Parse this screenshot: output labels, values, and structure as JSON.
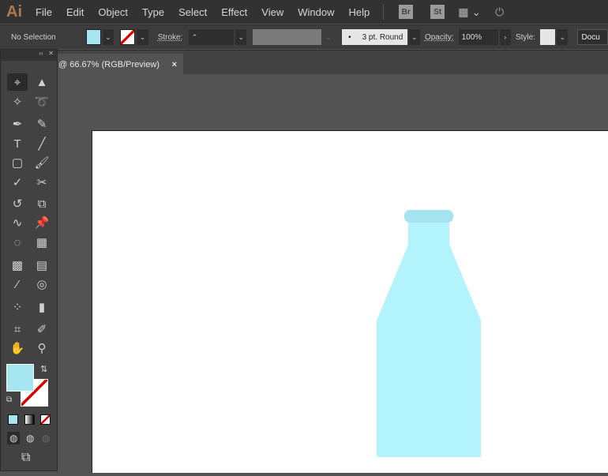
{
  "app": {
    "logo": "Ai"
  },
  "menu": [
    "File",
    "Edit",
    "Object",
    "Type",
    "Select",
    "Effect",
    "View",
    "Window",
    "Help"
  ],
  "app_buttons": {
    "bridge": "Br",
    "stock": "St"
  },
  "control": {
    "selection": "No Selection",
    "stroke_label": "Stroke:",
    "brush": "3 pt. Round",
    "opacity_label": "Opacity:",
    "opacity": "100%",
    "style_label": "Style:",
    "document_button": "Docu"
  },
  "tab": {
    "title": "@ 66.67% (RGB/Preview)",
    "close": "×"
  },
  "colors": {
    "fill": "#a6e6f0",
    "bottle": "#b3f3fb",
    "cap": "#a4e3ef",
    "canvas": "#535353"
  },
  "tools": [
    {
      "icon": "selection-tool",
      "g": "⌖"
    },
    {
      "icon": "direct-selection-tool",
      "g": "▲"
    },
    {
      "icon": "magic-wand-tool",
      "g": "✧"
    },
    {
      "icon": "lasso-tool",
      "g": "➰"
    },
    {
      "icon": "pen-tool",
      "g": "✒"
    },
    {
      "icon": "curvature-tool",
      "g": "✎"
    },
    {
      "icon": "type-tool",
      "g": "T"
    },
    {
      "icon": "line-tool",
      "g": "╱"
    },
    {
      "icon": "rectangle-tool",
      "g": "▢"
    },
    {
      "icon": "paintbrush-tool",
      "g": "🖌"
    },
    {
      "icon": "shaper-tool",
      "g": "✓"
    },
    {
      "icon": "scissors-tool",
      "g": "✂"
    },
    {
      "icon": "rotate-tool",
      "g": "↺"
    },
    {
      "icon": "scale-tool",
      "g": "⧉"
    },
    {
      "icon": "warp-tool",
      "g": "∿"
    },
    {
      "icon": "puppet-warp-tool",
      "g": "📌"
    },
    {
      "icon": "shape-builder-tool",
      "g": "◌"
    },
    {
      "icon": "perspective-grid-tool",
      "g": "▦"
    },
    {
      "icon": "mesh-tool",
      "g": "▩"
    },
    {
      "icon": "gradient-tool",
      "g": "▤"
    },
    {
      "icon": "eyedropper-tool",
      "g": "⁄"
    },
    {
      "icon": "blend-tool",
      "g": "◎"
    },
    {
      "icon": "symbol-sprayer-tool",
      "g": "⁘"
    },
    {
      "icon": "column-graph-tool",
      "g": "▮"
    },
    {
      "icon": "artboard-tool",
      "g": "⌗"
    },
    {
      "icon": "slice-tool",
      "g": "✐"
    },
    {
      "icon": "hand-tool",
      "g": "✋"
    },
    {
      "icon": "zoom-tool",
      "g": "⚲"
    }
  ]
}
